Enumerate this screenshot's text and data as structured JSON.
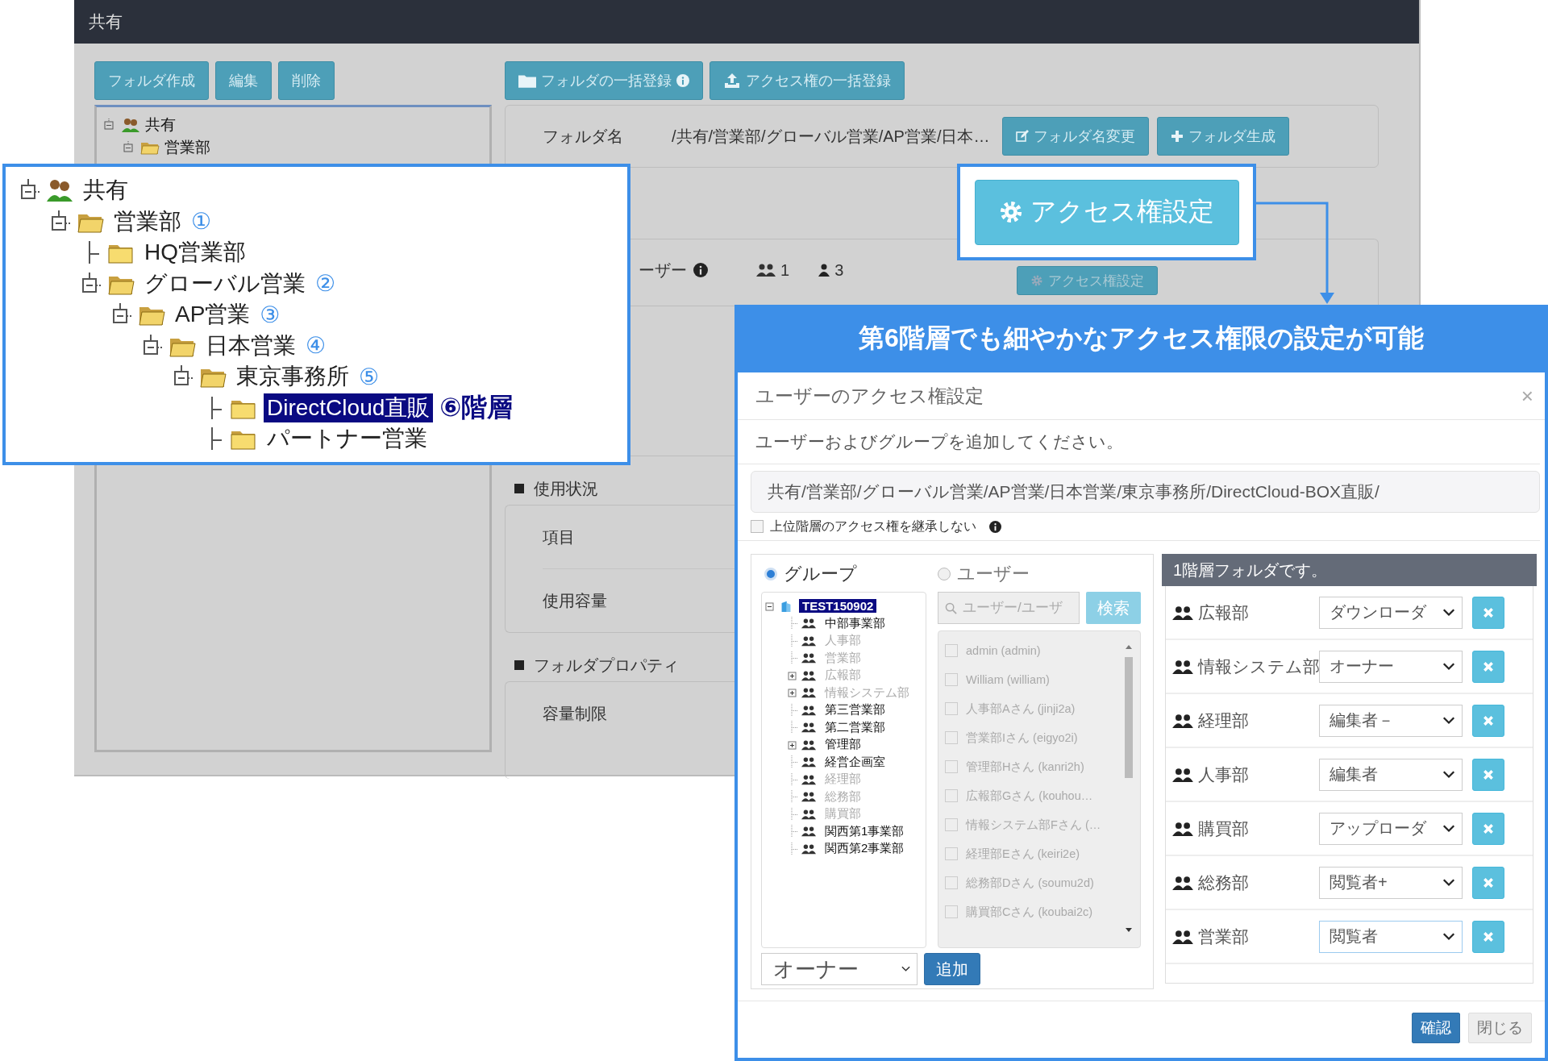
{
  "app": {
    "title": "共有",
    "left_buttons": [
      "フォルダ作成",
      "編集",
      "削除"
    ],
    "tree": [
      {
        "label": "共有",
        "kind": "root",
        "expanded": true,
        "children": [
          {
            "label": "営業部",
            "kind": "folder",
            "expanded": true
          }
        ]
      }
    ],
    "top_buttons": [
      {
        "label": "フォルダの一括登録",
        "kind": "folder",
        "info": true
      },
      {
        "label": "アクセス権の一括登録",
        "kind": "upload",
        "info": false
      }
    ],
    "folder_name": {
      "label": "フォルダ名",
      "value": "/共有/営業部/グローバル営業/AP営業/日本…",
      "buttons": [
        {
          "label": "フォルダ名変更",
          "kind": "edit"
        },
        {
          "label": "フォルダ生成",
          "kind": "plus"
        }
      ]
    },
    "access": {
      "label": "ーザー",
      "group_count": "1",
      "user_count": "3",
      "button": "アクセス権設定"
    },
    "usage": {
      "heading": "使用状況",
      "rows": [
        "項目",
        "使用容量"
      ]
    },
    "properties": {
      "heading": "フォルダプロパティ",
      "rows": [
        "容量制限"
      ]
    }
  },
  "zoom_callout": {
    "tree": [
      {
        "label": "共有",
        "kind": "root",
        "expanded": true,
        "selected": false,
        "children": [
          {
            "label": "営業部",
            "kind": "folder",
            "marker": "①",
            "expanded": true,
            "selected": false,
            "children": [
              {
                "label": "HQ営業部",
                "kind": "folder",
                "selected": false
              },
              {
                "label": "グローバル営業",
                "kind": "folder",
                "marker": "②",
                "expanded": true,
                "selected": false,
                "children": [
                  {
                    "label": "AP営業",
                    "kind": "folder",
                    "marker": "③",
                    "expanded": true,
                    "selected": false,
                    "children": [
                      {
                        "label": "日本営業",
                        "kind": "folder",
                        "marker": "④",
                        "expanded": true,
                        "selected": false,
                        "children": [
                          {
                            "label": "東京事務所",
                            "kind": "folder",
                            "marker": "⑤",
                            "expanded": true,
                            "selected": false,
                            "children": [
                              {
                                "label": "DirectCloud直販",
                                "kind": "folder",
                                "marker": "⑥階層",
                                "selected": true
                              },
                              {
                                "label": "パートナー営業",
                                "kind": "folder",
                                "selected": false
                              }
                            ]
                          }
                        ]
                      }
                    ]
                  }
                ]
              }
            ]
          }
        ]
      }
    ]
  },
  "button_callout": {
    "label": "アクセス権設定"
  },
  "banner": "第6階層でも細やかなアクセス権限の設定が可能",
  "dialog": {
    "title": "ユーザーのアクセス権設定",
    "close": "×",
    "instruction": "ユーザーおよびグループを追加してください。",
    "path": "共有/営業部/グローバル営業/AP営業/日本営業/東京事務所/DirectCloud-BOX直販/",
    "inherit": {
      "label": "上位階層のアクセス権を継承しない",
      "checked": false
    },
    "modes": [
      {
        "label": "グループ",
        "selected": true
      },
      {
        "label": "ユーザー",
        "selected": false
      }
    ],
    "group_tree": [
      {
        "label": "TEST150902",
        "kind": "org",
        "expanded": true,
        "selected": true,
        "disabled": false,
        "children": [
          {
            "label": "中部事業部",
            "kind": "group",
            "selected": false,
            "disabled": false
          },
          {
            "label": "人事部",
            "kind": "group",
            "selected": false,
            "disabled": true
          },
          {
            "label": "営業部",
            "kind": "group",
            "selected": false,
            "disabled": true
          },
          {
            "label": "広報部",
            "kind": "group",
            "expanded": false,
            "selected": false,
            "disabled": true
          },
          {
            "label": "情報システム部",
            "kind": "group",
            "expanded": false,
            "selected": false,
            "disabled": true
          },
          {
            "label": "第三営業部",
            "kind": "group",
            "selected": false,
            "disabled": false
          },
          {
            "label": "第二営業部",
            "kind": "group",
            "selected": false,
            "disabled": false
          },
          {
            "label": "管理部",
            "kind": "group",
            "expanded": false,
            "selected": false,
            "disabled": false
          },
          {
            "label": "経営企画室",
            "kind": "group",
            "selected": false,
            "disabled": false
          },
          {
            "label": "経理部",
            "kind": "group",
            "selected": false,
            "disabled": true
          },
          {
            "label": "総務部",
            "kind": "group",
            "selected": false,
            "disabled": true
          },
          {
            "label": "購買部",
            "kind": "group",
            "selected": false,
            "disabled": true
          },
          {
            "label": "関西第1事業部",
            "kind": "group",
            "selected": false,
            "disabled": false
          },
          {
            "label": "関西第2事業部",
            "kind": "group",
            "selected": false,
            "disabled": false
          }
        ]
      }
    ],
    "search": {
      "placeholder": "ユーザー/ユーザ",
      "button": "検索"
    },
    "users": [
      {
        "label": "admin (admin)",
        "checked": false
      },
      {
        "label": "William (william)",
        "checked": false
      },
      {
        "label": "人事部Aさん (jinji2a)",
        "checked": false
      },
      {
        "label": "営業部Iさん (eigyo2i)",
        "checked": false
      },
      {
        "label": "管理部Hさん (kanri2h)",
        "checked": false
      },
      {
        "label": "広報部Gさん (kouhou…",
        "checked": false
      },
      {
        "label": "情報システム部Fさん (…",
        "checked": false
      },
      {
        "label": "経理部Eさん (keiri2e)",
        "checked": false
      },
      {
        "label": "総務部Dさん (soumu2d)",
        "checked": false
      },
      {
        "label": "購買部Cさん (koubai2c)",
        "checked": false
      }
    ],
    "role": "オーナー",
    "add": "追加",
    "assigned_header": "1階層フォルダです。",
    "assigned": [
      {
        "name": "広報部",
        "role": "ダウンローダ",
        "focused": false
      },
      {
        "name": "情報システム部",
        "role": "オーナー",
        "focused": false
      },
      {
        "name": "経理部",
        "role": "編集者－",
        "focused": false
      },
      {
        "name": "人事部",
        "role": "編集者",
        "focused": false
      },
      {
        "name": "購買部",
        "role": "アップローダ",
        "focused": false
      },
      {
        "name": "総務部",
        "role": "閲覧者+",
        "focused": false
      },
      {
        "name": "営業部",
        "role": "閲覧者",
        "focused": true
      }
    ],
    "buttons": [
      {
        "label": "確認",
        "kind": "primary"
      },
      {
        "label": "閉じる",
        "kind": "default"
      }
    ]
  }
}
